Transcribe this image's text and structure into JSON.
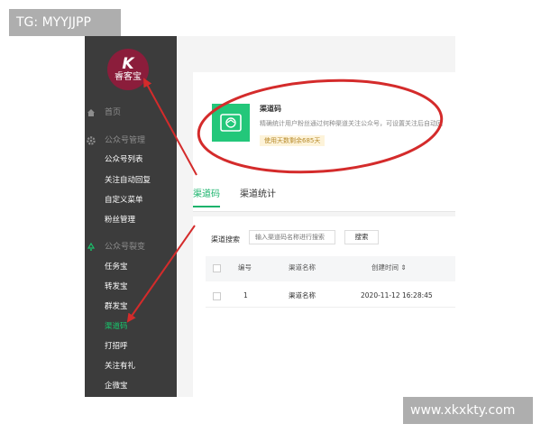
{
  "watermarks": {
    "top_left": "TG: MYYJJPP",
    "bottom_right": "www.xkxkty.com"
  },
  "logo": {
    "mark": "K",
    "text": "睿客宝"
  },
  "sidebar": {
    "home": "首页",
    "group1": "公众号管理",
    "group1_items": [
      "公众号列表",
      "关注自动回复",
      "自定义菜单",
      "粉丝管理"
    ],
    "group2": "公众号裂变",
    "group2_items": [
      "任务宝",
      "转发宝",
      "群发宝",
      "渠道码",
      "打招呼",
      "关注有礼",
      "企微宝"
    ],
    "active_item": "渠道码"
  },
  "card": {
    "title": "渠道码",
    "description": "精确统计用户粉丝通过何种渠道关注公众号，可设置关注后自动回",
    "badge": "使用天数剩余685天"
  },
  "tabs": [
    "渠道码",
    "渠道统计"
  ],
  "search": {
    "label": "渠道搜索",
    "placeholder": "输入渠道码名称进行搜索",
    "button": "搜索"
  },
  "table": {
    "columns": [
      "编号",
      "渠道名称",
      "创建时间 ⇕"
    ],
    "rows": [
      {
        "id": "1",
        "name": "渠道名称",
        "created": "2020-11-12 16:28:45"
      }
    ]
  },
  "colors": {
    "sidebar_bg": "#3c3c3c",
    "accent_green": "#19b36b",
    "annotation_red": "#d42b2b",
    "logo_bg": "#8b1d3b"
  }
}
